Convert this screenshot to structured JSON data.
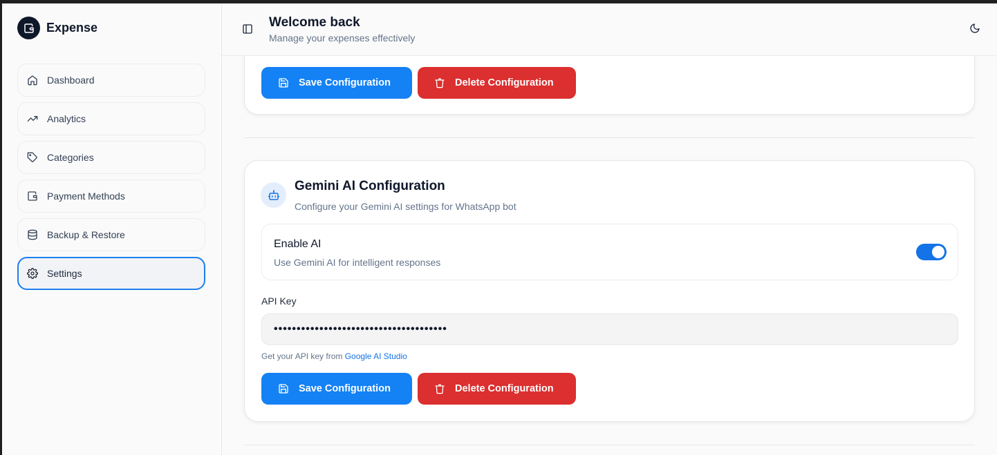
{
  "brand": {
    "name": "Expense",
    "logo_icon": "wallet-icon"
  },
  "sidebar": {
    "items": [
      {
        "label": "Dashboard",
        "icon": "home-icon",
        "active": false
      },
      {
        "label": "Analytics",
        "icon": "trending-up-icon",
        "active": false
      },
      {
        "label": "Categories",
        "icon": "tag-icon",
        "active": false
      },
      {
        "label": "Payment Methods",
        "icon": "wallet-icon",
        "active": false
      },
      {
        "label": "Backup & Restore",
        "icon": "database-icon",
        "active": false
      },
      {
        "label": "Settings",
        "icon": "gear-icon",
        "active": true
      }
    ]
  },
  "header": {
    "title": "Welcome back",
    "subtitle": "Manage your expenses effectively"
  },
  "top_card": {
    "save_label": "Save Configuration",
    "delete_label": "Delete Configuration"
  },
  "gemini": {
    "title": "Gemini AI Configuration",
    "subtitle": "Configure your Gemini AI settings for WhatsApp bot",
    "enable": {
      "title": "Enable AI",
      "description": "Use Gemini AI for intelligent responses",
      "enabled": true
    },
    "api_key": {
      "label": "API Key",
      "value": "••••••••••••••••••••••••••••••••••••••",
      "hint_prefix": "Get your API key from ",
      "hint_link": "Google AI Studio"
    },
    "save_label": "Save Configuration",
    "delete_label": "Delete Configuration"
  },
  "colors": {
    "primary": "#1481f5",
    "danger": "#dc2f2f",
    "active_border": "#1d7ff0"
  }
}
